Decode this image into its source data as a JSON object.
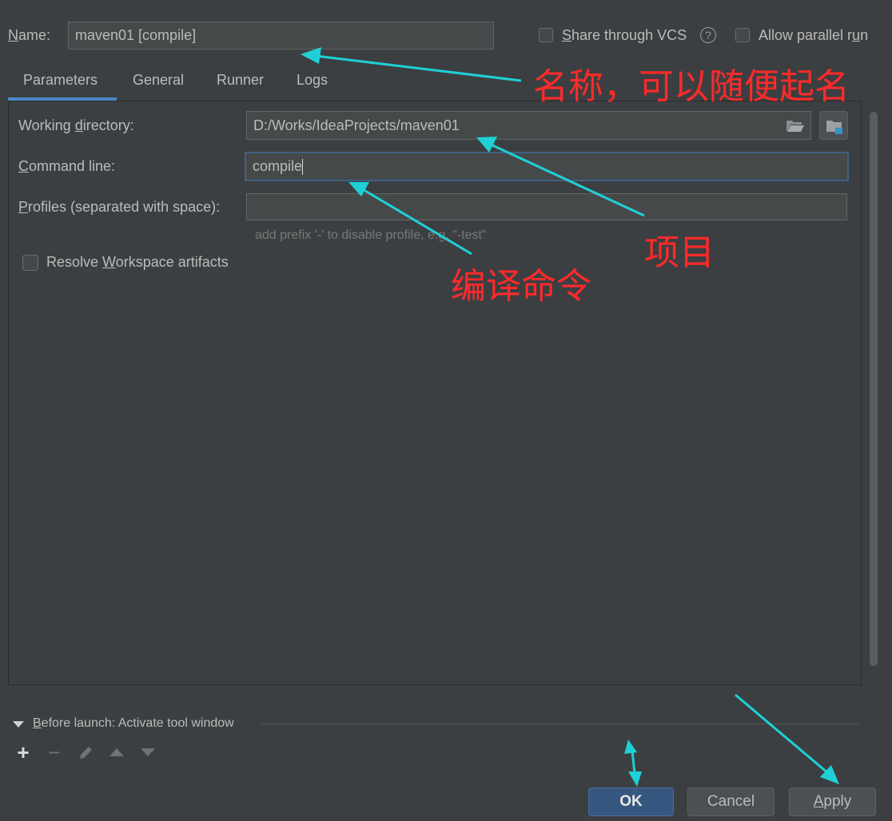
{
  "name": {
    "label": "Name:",
    "mnemonic": "N",
    "rest": "ame:",
    "value": "maven01 [compile]"
  },
  "options": {
    "share_vcs": {
      "mnemonic": "S",
      "rest": "hare through VCS",
      "checked": false
    },
    "help_icon": "question-circle-icon",
    "parallel_run": {
      "before": "Allow parallel r",
      "mnemonic": "u",
      "after": "n",
      "checked": false
    }
  },
  "tabs": [
    "Parameters",
    "General",
    "Runner",
    "Logs"
  ],
  "active_tab": "Parameters",
  "fields": {
    "working_directory": {
      "before": "Working ",
      "mnemonic": "d",
      "after": "irectory:",
      "value": "D:/Works/IdeaProjects/maven01"
    },
    "command_line": {
      "mnemonic": "C",
      "after": "ommand line:",
      "value": "compile"
    },
    "profiles": {
      "mnemonic": "P",
      "after": "rofiles (separated with space):",
      "value": "",
      "hint": "add prefix '-' to disable profile, e.g. \"-test\""
    }
  },
  "resolve_workspace": {
    "before": "Resolve ",
    "mnemonic": "W",
    "after": "orkspace artifacts",
    "checked": false
  },
  "before_launch": {
    "mnemonic": "B",
    "after": "efore launch: Activate tool window"
  },
  "buttons": {
    "ok": "OK",
    "cancel": "Cancel",
    "apply_mnemonic": "A",
    "apply_rest": "pply"
  },
  "annotations": {
    "name_note": "名称，可以随便起名",
    "project_note": "项目",
    "command_note": "编译命令"
  },
  "colors": {
    "background": "#3c3f41",
    "accent_tab": "#4a88c7",
    "ok_button": "#365880",
    "annotation_red": "#ff2a2a",
    "arrow_cyan": "#1fd0d6"
  }
}
